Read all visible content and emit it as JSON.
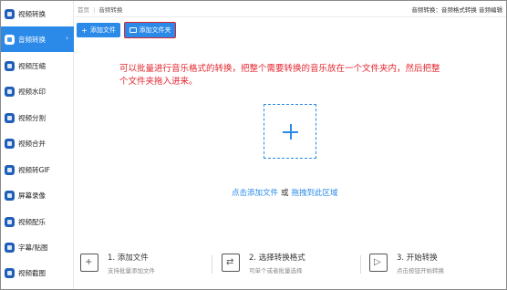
{
  "sidebar": {
    "items": [
      {
        "label": "视频转换"
      },
      {
        "label": "音频转换"
      },
      {
        "label": "视频压缩"
      },
      {
        "label": "视频水印"
      },
      {
        "label": "视频分割"
      },
      {
        "label": "视频合并"
      },
      {
        "label": "视频转GIF"
      },
      {
        "label": "屏幕录像"
      },
      {
        "label": "视频配乐"
      },
      {
        "label": "字幕/贴图"
      },
      {
        "label": "视频截图"
      }
    ],
    "active_arrow": "›"
  },
  "header": {
    "breadcrumb_home": "首页",
    "breadcrumb_sep": "|",
    "breadcrumb_current": "音频转换",
    "right_text": "音频转换：音频格式转换 音频编辑"
  },
  "toolbar": {
    "add_file_label": "添加文件",
    "add_folder_label": "添加文件夹"
  },
  "annotation": {
    "text": "可以批量进行音乐格式的转换，把整个需要转换的音乐放在一个文件夹内，然后把整个文件夹拖入进来。"
  },
  "dropzone": {
    "click_add_text": "点击添加文件",
    "or_text": "或",
    "drag_text": "拖拽到此区域"
  },
  "steps": [
    {
      "title": "1. 添加文件",
      "desc": "支持批量添加文件",
      "icon": "add-file-icon"
    },
    {
      "title": "2. 选择转换格式",
      "desc": "可单个或者批量选择",
      "icon": "convert-format-icon"
    },
    {
      "title": "3. 开始转换",
      "desc": "点击按钮开始转换",
      "icon": "start-convert-icon"
    }
  ],
  "colors": {
    "accent": "#2b8ae8",
    "annotation_red": "#e3262f",
    "highlight_border": "#d9232e"
  }
}
